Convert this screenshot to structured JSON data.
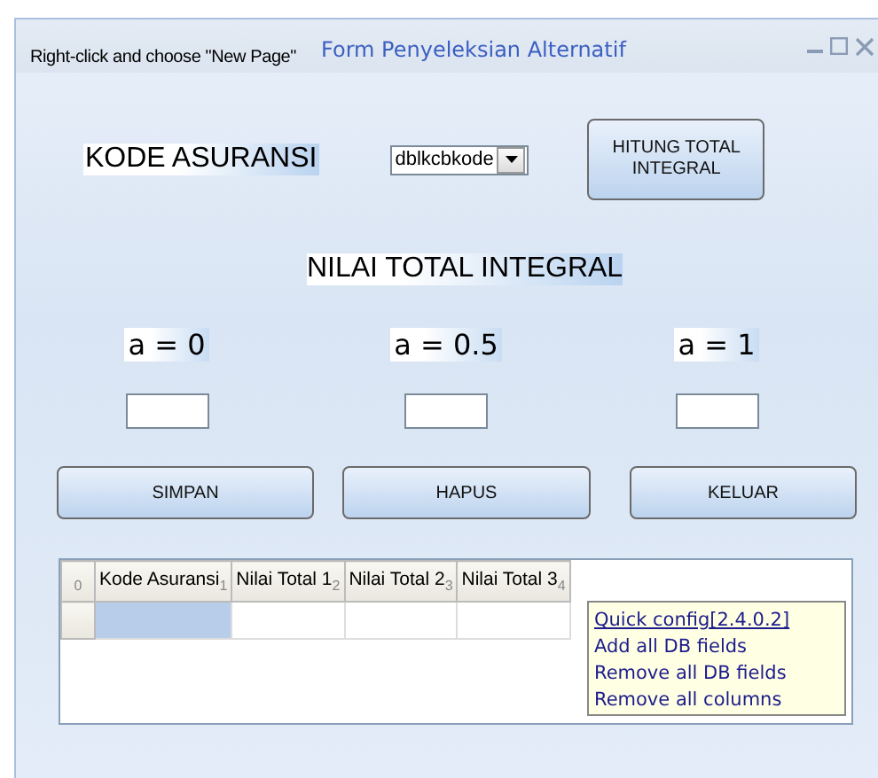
{
  "window": {
    "title": "Form Penyeleksian Alternatif",
    "hint": "Right-click and choose \"New Page\""
  },
  "kode": {
    "label": "KODE ASURANSI",
    "dropdown_value": "dblkcbkode",
    "button": "HITUNG TOTAL INTEGRAL"
  },
  "heading": "NILAI TOTAL INTEGRAL",
  "alphas": [
    {
      "label": "a = 0"
    },
    {
      "label": "a = 0.5"
    },
    {
      "label": "a = 1"
    }
  ],
  "buttons": [
    "SIMPAN",
    "HAPUS",
    "KELUAR"
  ],
  "grid": {
    "corner_index": "0",
    "columns": [
      {
        "label": "Kode Asuransi",
        "index": "1"
      },
      {
        "label": "Nilai Total 1",
        "index": "2"
      },
      {
        "label": "Nilai Total 2",
        "index": "3"
      },
      {
        "label": "Nilai Total 3",
        "index": "4"
      }
    ]
  },
  "quick_menu": [
    {
      "label": "Quick config[2.4.0.2]",
      "kind": "link"
    },
    {
      "label": "Add all DB fields",
      "kind": "item"
    },
    {
      "label": "Remove all DB fields",
      "kind": "item"
    },
    {
      "label": "Remove all columns",
      "kind": "item"
    }
  ]
}
